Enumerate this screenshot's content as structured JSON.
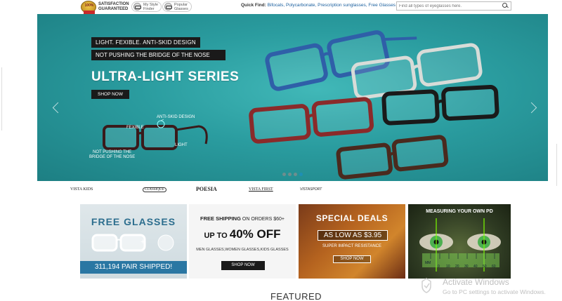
{
  "topbar": {
    "medal_text": "100%",
    "satisfaction_line1": "SATISFACTION",
    "satisfaction_line2": "GUARANTEED",
    "my_style_line1": "My Style",
    "my_style_line2": "Finder",
    "popular_line1": "Popular",
    "popular_line2": "Glasses",
    "quick_find_label": "Quick Find:",
    "quick_links": [
      "Bifocals,",
      "Polycarbonate,",
      "Prescription sunglasses,",
      "Free Glasses"
    ],
    "search_placeholder": "Find all types of eyeglasses here."
  },
  "hero": {
    "tag1": "LIGHT. FEXIBLE. ANTI-SKID DESIGN",
    "tag2": "NOT PUSHING THE BRIDGE OF THE NOSE",
    "title": "ULTRA-LIGHT SERIES",
    "shop_label": "SHOP NOW",
    "callout_antiskid": "ANTI-SKID DESIGN",
    "callout_fexible": "FEXIBLE",
    "callout_light": "LIGHT",
    "callout_nose_line1": "NOT PUSHING THE",
    "callout_nose_line2": "BRIDGE OF THE NOSE",
    "slide_count": 4,
    "active_slide": 4
  },
  "brands": [
    "VISTA KIDS",
    "CLASSIQUE",
    "POESIA",
    "VISTA FIRST",
    "VISTASPORT"
  ],
  "cards": {
    "free_glasses": {
      "title": "FREE GLASSES",
      "plus": "+",
      "count_text": "311,194 PAIR SHIPPED!"
    },
    "free_shipping": {
      "line_bold": "FREE SHIPPING",
      "line_rest": " ON ORDERS $60+",
      "upto": "UP TO ",
      "pct": "40% OFF",
      "categories": "MEN GLASSES,WOMEN GLASSES,KIDS GLASSES",
      "shop_label": "SHOP NOW"
    },
    "special_deals": {
      "title": "SPECIAL DEALS",
      "price_text": "AS LOW AS $3.95",
      "subtitle": "SUPER IMPACT RESISTANCE",
      "shop_label": "SHOP NOW"
    },
    "measure_pd": {
      "title": "MEASURING YOUR OWN PD",
      "scale_unit": "MM",
      "scale_labels": [
        "0",
        "10",
        "20",
        "30",
        "40",
        "50",
        "60"
      ]
    }
  },
  "featured_heading": "FEATURED",
  "watermark": {
    "title": "Activate Windows",
    "subtitle": "Go to PC settings to activate Windows."
  },
  "colors": {
    "hero_teal": "#2a9c9f",
    "link_blue": "#1a5f9e",
    "card1_bar": "#2a77a3",
    "active_dot": "#1e8fb5"
  }
}
